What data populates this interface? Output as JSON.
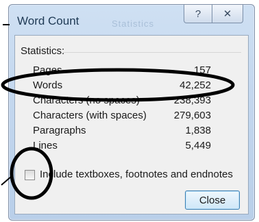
{
  "window": {
    "title": "Word Count",
    "watermark": "Statistics",
    "help_glyph": "?",
    "close_glyph": "✕"
  },
  "statistics": {
    "group_label": "Statistics:",
    "rows": [
      {
        "label": "Pages",
        "value": "157"
      },
      {
        "label": "Words",
        "value": "42,252"
      },
      {
        "label": "Characters (no spaces)",
        "value": "238,393"
      },
      {
        "label": "Characters (with spaces)",
        "value": "279,603"
      },
      {
        "label": "Paragraphs",
        "value": "1,838"
      },
      {
        "label": "Lines",
        "value": "5,449"
      }
    ]
  },
  "options": {
    "include_label": "Include textboxes, footnotes and endnotes",
    "include_checked": false
  },
  "buttons": {
    "close_label": "Close"
  },
  "annotations": {
    "stroke_color": "#000000"
  }
}
